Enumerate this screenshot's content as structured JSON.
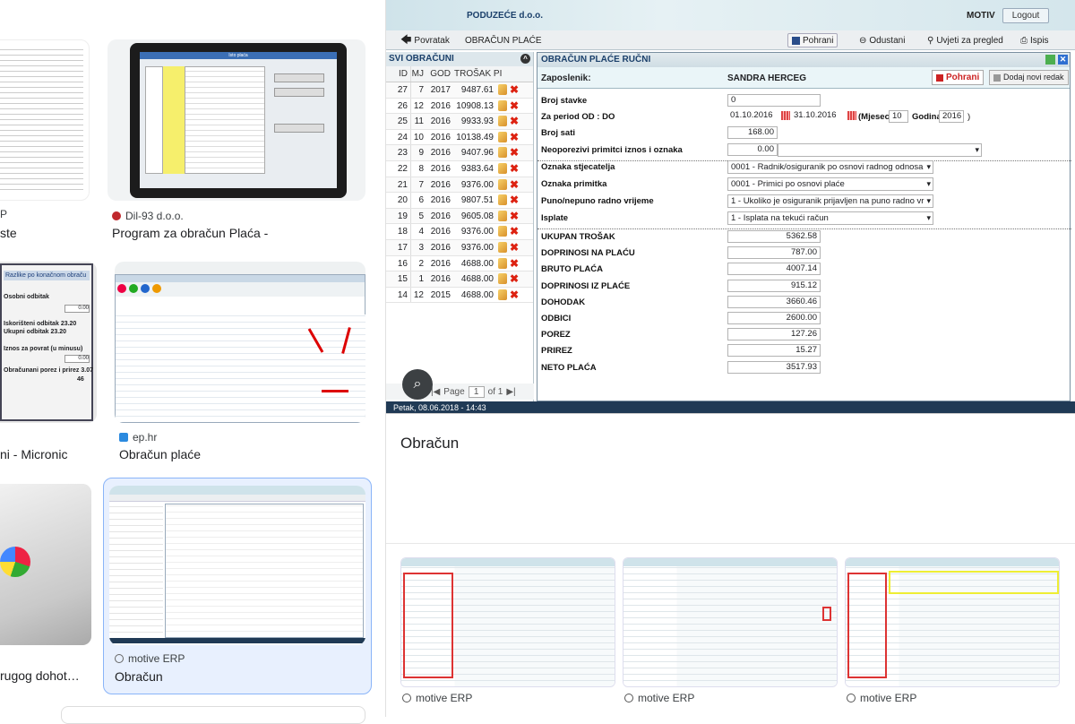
{
  "left_results": [
    {
      "source": "P",
      "title": "ste"
    },
    {
      "source": "Dil-93 d.o.o.",
      "title": "Program za obračun Plaća -"
    },
    {
      "source": "",
      "title": "ni - Micronic"
    },
    {
      "source": "ep.hr",
      "title": "Obračun plaće"
    },
    {
      "source": "",
      "title": "rugog dohot…"
    },
    {
      "source": "motive ERP",
      "title": "Obračun"
    }
  ],
  "thumb_texts": {
    "dil_window_title": "Isto plaća",
    "micronic_header": "Razlike po konačnom obraču",
    "micronic_rows": [
      {
        "label": "Osobni odbitak",
        "value": "0.00"
      },
      {
        "label": "Iskorišteni odbitak",
        "value": "23.20"
      },
      {
        "label": "Ukupni odbitak",
        "value": "23.20"
      },
      {
        "label": "Iznos za povrat (u minusu)",
        "value": "0.00"
      },
      {
        "label": "Obračunani porez i prirez",
        "value": "3.07"
      }
    ],
    "micronic_tail": "46"
  },
  "app": {
    "company": "PODUZEĆE d.o.o.",
    "user": "MOTIV",
    "logout": "Logout",
    "back": "Povratak",
    "screen_title": "OBRAČUN PLAĆE",
    "toolbar": {
      "save": "Pohrani",
      "cancel": "Odustani",
      "conditions": "Uvjeti za pregled",
      "print": "Ispis"
    },
    "left_panel": {
      "title": "SVI OBRAČUNI",
      "columns": [
        "ID",
        "MJ",
        "GOD",
        "TROŠAK PI"
      ],
      "rows": [
        {
          "id": "27",
          "mj": "7",
          "god": "2017",
          "trosak": "9487.61"
        },
        {
          "id": "26",
          "mj": "12",
          "god": "2016",
          "trosak": "10908.13"
        },
        {
          "id": "25",
          "mj": "11",
          "god": "2016",
          "trosak": "9933.93"
        },
        {
          "id": "24",
          "mj": "10",
          "god": "2016",
          "trosak": "10138.49"
        },
        {
          "id": "23",
          "mj": "9",
          "god": "2016",
          "trosak": "9407.96"
        },
        {
          "id": "22",
          "mj": "8",
          "god": "2016",
          "trosak": "9383.64"
        },
        {
          "id": "21",
          "mj": "7",
          "god": "2016",
          "trosak": "9376.00"
        },
        {
          "id": "20",
          "mj": "6",
          "god": "2016",
          "trosak": "9807.51"
        },
        {
          "id": "19",
          "mj": "5",
          "god": "2016",
          "trosak": "9605.08"
        },
        {
          "id": "18",
          "mj": "4",
          "god": "2016",
          "trosak": "9376.00"
        },
        {
          "id": "17",
          "mj": "3",
          "god": "2016",
          "trosak": "9376.00"
        },
        {
          "id": "16",
          "mj": "2",
          "god": "2016",
          "trosak": "4688.00"
        },
        {
          "id": "15",
          "mj": "1",
          "god": "2016",
          "trosak": "4688.00"
        },
        {
          "id": "14",
          "mj": "12",
          "god": "2015",
          "trosak": "4688.00"
        }
      ],
      "pager": {
        "label": "Page",
        "value": "1",
        "of": "of 1"
      }
    },
    "form": {
      "title": "OBRAČUN PLAĆE RUČNI",
      "employee_label": "Zaposlenik:",
      "employee": "SANDRA HERCEG",
      "save": "Pohrani",
      "add_row": "Dodaj novi redak",
      "fields": {
        "broj_stavke": {
          "label": "Broj stavke",
          "value": "0"
        },
        "period": {
          "label": "Za period OD : DO",
          "from": "01.10.2016",
          "to": "31.10.2016",
          "month_label": "(Mjesec",
          "month": "10",
          "year_label": "Godina",
          "year": "2016",
          "close": ")"
        },
        "broj_sati": {
          "label": "Broj sati",
          "value": "168.00"
        },
        "neoporezivi": {
          "label": "Neoporezivi primitci iznos i oznaka",
          "value": "0.00"
        },
        "oznaka_stjecatelja": {
          "label": "Oznaka stjecatelja",
          "value": "0001 - Radnik/osiguranik po osnovi radnog odnosa"
        },
        "oznaka_primitka": {
          "label": "Oznaka primitka",
          "value": "0001 - Primici po osnovi plaće"
        },
        "radno_vrijeme": {
          "label": "Puno/nepuno radno vrijeme",
          "value": "1 - Ukoliko je osiguranik prijavljen na puno radno vr"
        },
        "isplate": {
          "label": "Isplate",
          "value": "1 - Isplata na tekući račun"
        }
      },
      "totals": [
        {
          "label": "UKUPAN TROŠAK",
          "value": "5362.58"
        },
        {
          "label": "DOPRINOSI NA PLAĆU",
          "value": "787.00"
        },
        {
          "label": "BRUTO PLAĆA",
          "value": "4007.14"
        },
        {
          "label": "DOPRINOSI IZ PLAĆE",
          "value": "915.12"
        },
        {
          "label": "DOHODAK",
          "value": "3660.46"
        },
        {
          "label": "ODBICI",
          "value": "2600.00"
        },
        {
          "label": "POREZ",
          "value": "127.26"
        },
        {
          "label": "PRIREZ",
          "value": "15.27"
        },
        {
          "label": "NETO PLAĆA",
          "value": "3517.93"
        }
      ]
    },
    "status": "Petak, 08.06.2018 - 14:43"
  },
  "caption": "Obračun",
  "related": [
    {
      "source": "motive ERP"
    },
    {
      "source": "motive ERP"
    },
    {
      "source": "motive ERP"
    }
  ],
  "colors": {
    "accent": "#1a3f6a",
    "delete": "#d21111",
    "selected_border": "#8ab4f8"
  }
}
